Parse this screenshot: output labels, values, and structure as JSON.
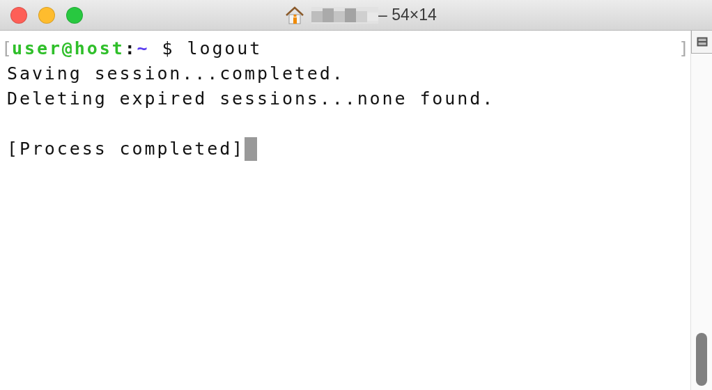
{
  "window": {
    "title": "– 54×14",
    "title_redacted": true
  },
  "terminal": {
    "prompt": {
      "mark_open": "[",
      "user_host": "user@host",
      "separator": ":",
      "path": "~",
      "symbol": "$",
      "command": "logout",
      "mark_close": "]"
    },
    "output": [
      "Saving session...completed.",
      "Deleting expired sessions...none found."
    ],
    "status": "[Process completed]",
    "cursor_visible": true
  }
}
